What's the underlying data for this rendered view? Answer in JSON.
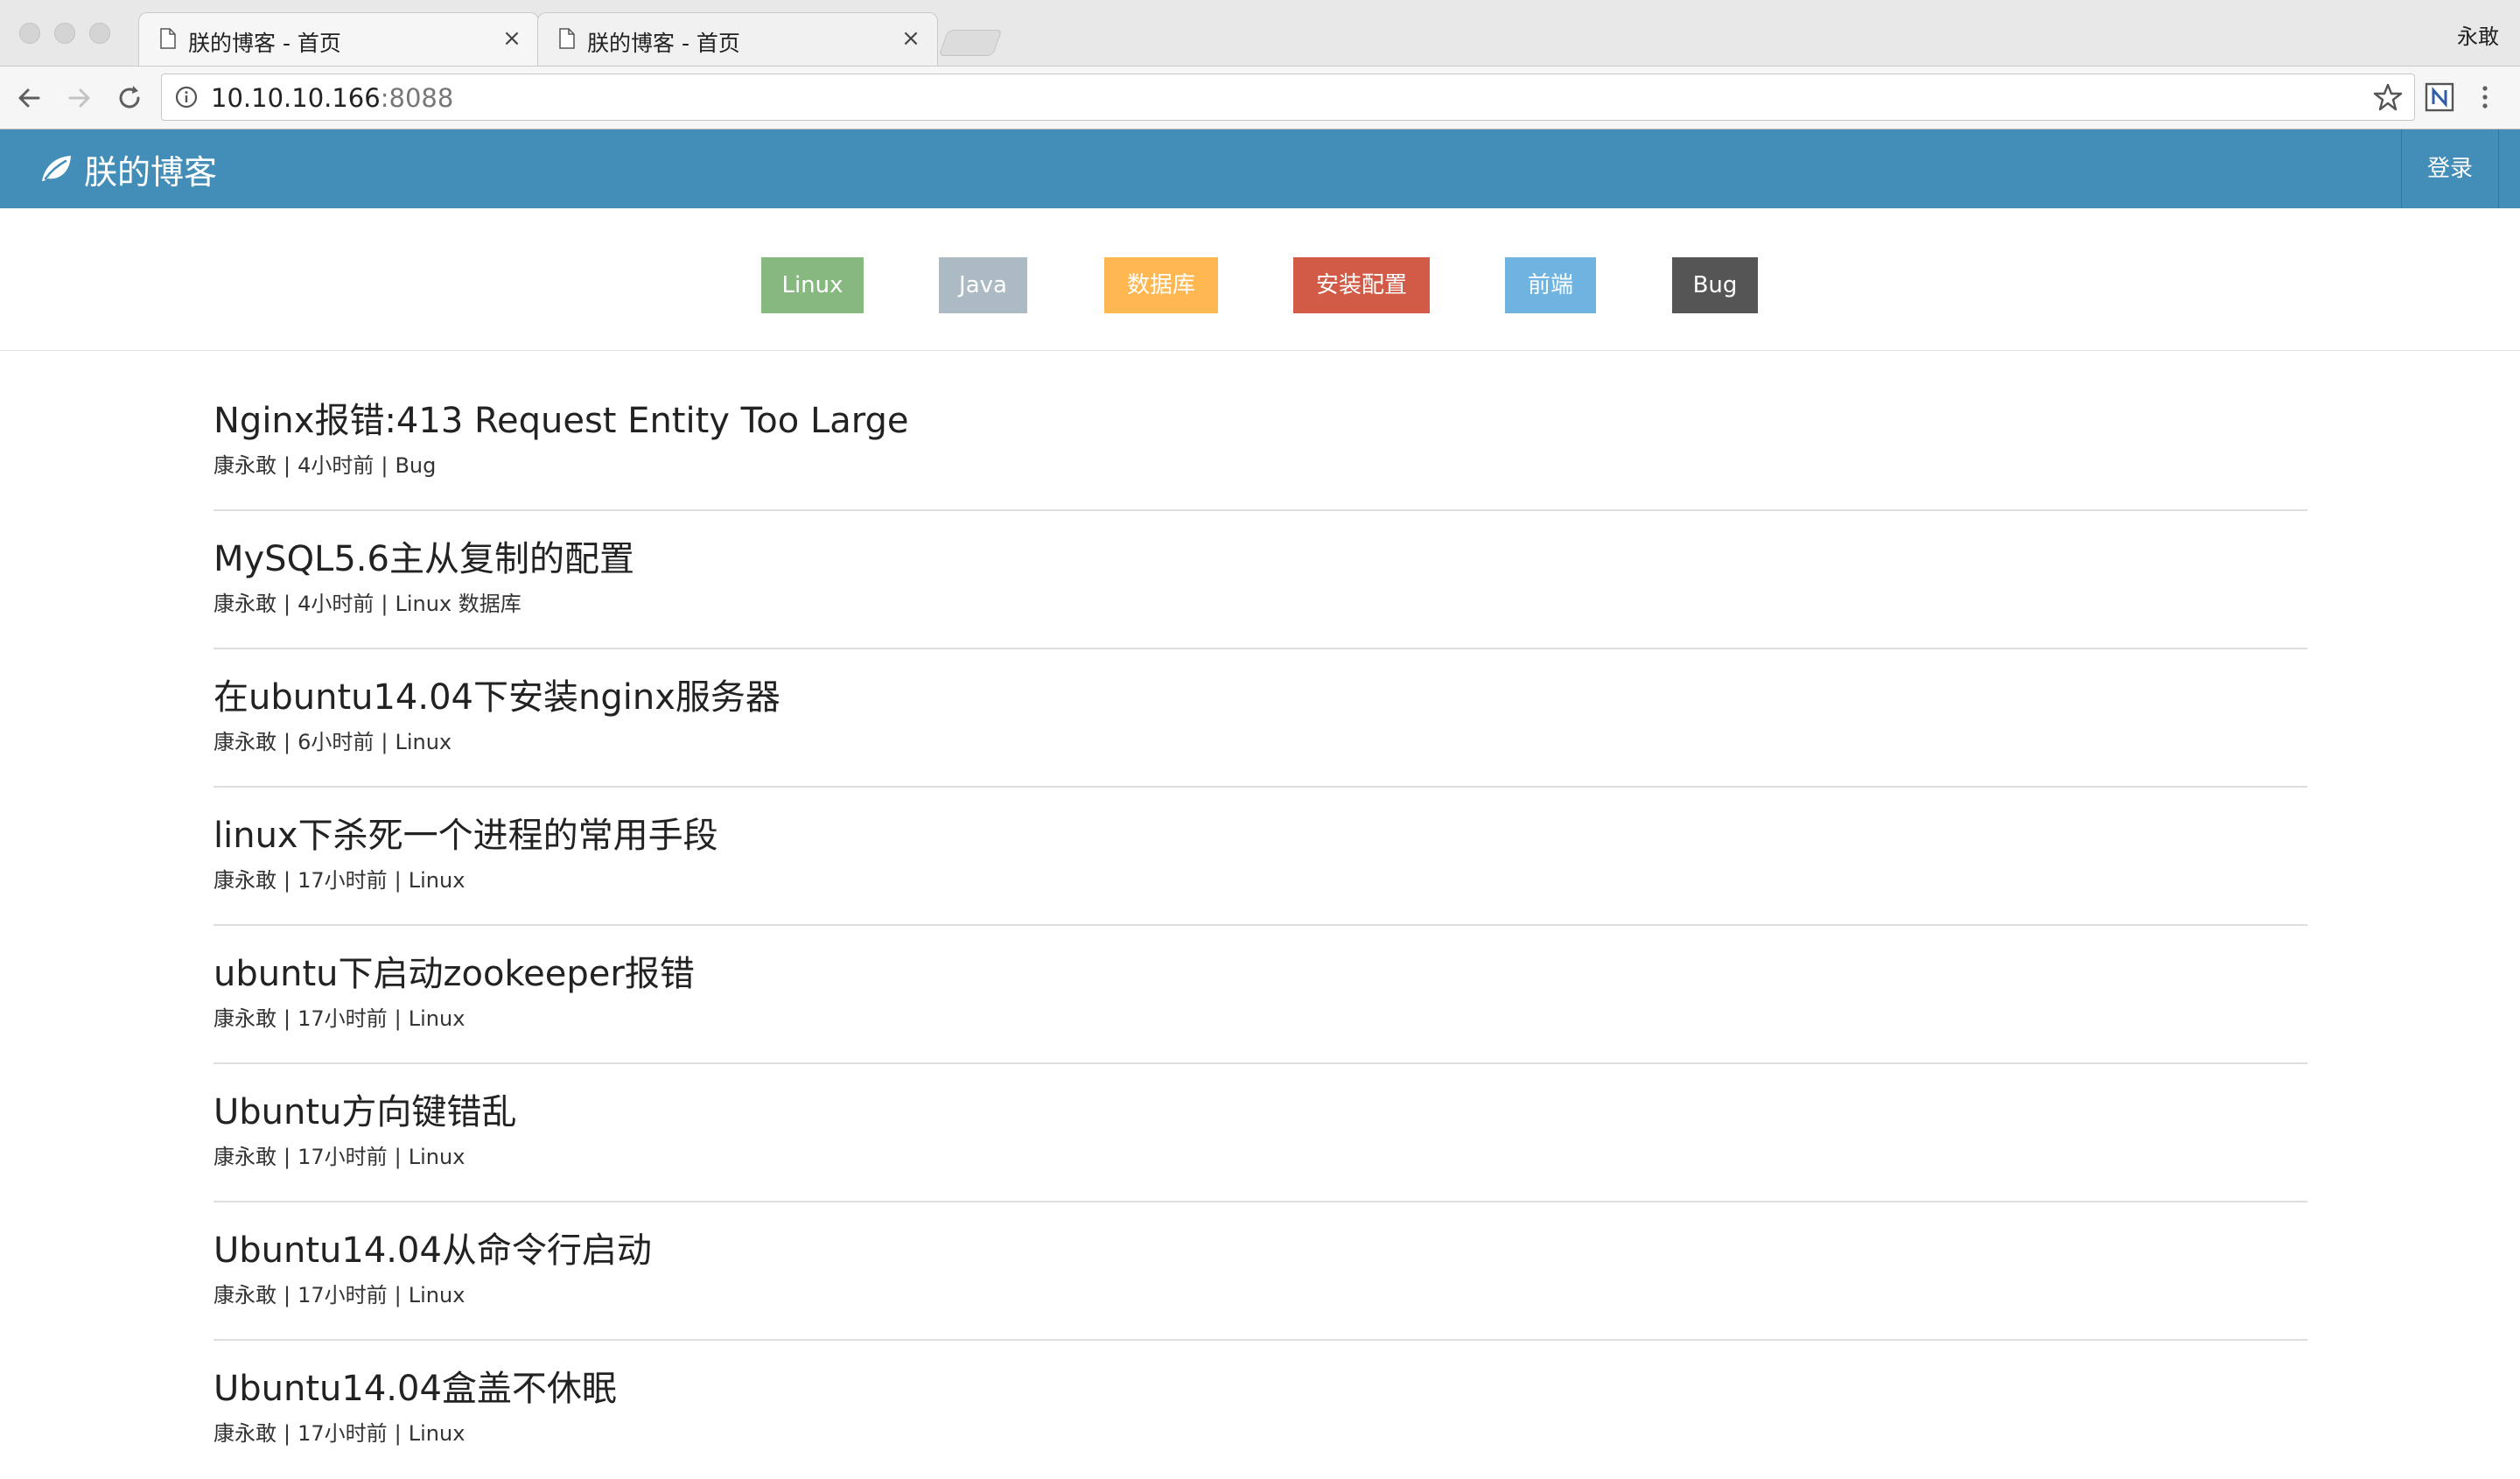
{
  "browser": {
    "tabs": [
      {
        "title": "朕的博客 - 首页",
        "close": "×"
      },
      {
        "title": "朕的博客 - 首页",
        "close": "×"
      }
    ],
    "profile_name": "永敢",
    "url_host": "10.10.10.166",
    "url_port": ":8088"
  },
  "site": {
    "brand": "朕的博客",
    "login": "登录"
  },
  "categories": [
    {
      "label": "Linux",
      "color": "#87b87f"
    },
    {
      "label": "Java",
      "color": "#abbac3"
    },
    {
      "label": "数据库",
      "color": "#ffb752"
    },
    {
      "label": "安装配置",
      "color": "#d15b47"
    },
    {
      "label": "前端",
      "color": "#6fb3e0"
    },
    {
      "label": "Bug",
      "color": "#555555"
    }
  ],
  "posts": [
    {
      "title": "Nginx报错:413 Request Entity Too Large",
      "author": "康永敢",
      "time": "4小时前",
      "tags": "Bug"
    },
    {
      "title": "MySQL5.6主从复制的配置",
      "author": "康永敢",
      "time": "4小时前",
      "tags": "Linux 数据库"
    },
    {
      "title": "在ubuntu14.04下安装nginx服务器",
      "author": "康永敢",
      "time": "6小时前",
      "tags": "Linux"
    },
    {
      "title": "linux下杀死一个进程的常用手段",
      "author": "康永敢",
      "time": "17小时前",
      "tags": "Linux"
    },
    {
      "title": "ubuntu下启动zookeeper报错",
      "author": "康永敢",
      "time": "17小时前",
      "tags": "Linux"
    },
    {
      "title": "Ubuntu方向键错乱",
      "author": "康永敢",
      "time": "17小时前",
      "tags": "Linux"
    },
    {
      "title": "Ubuntu14.04从命令行启动",
      "author": "康永敢",
      "time": "17小时前",
      "tags": "Linux"
    },
    {
      "title": "Ubuntu14.04盒盖不休眠",
      "author": "康永敢",
      "time": "17小时前",
      "tags": "Linux"
    }
  ],
  "meta_separator": "|"
}
